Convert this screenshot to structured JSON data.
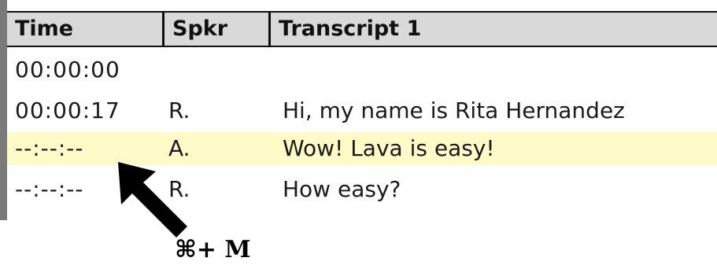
{
  "columns": {
    "time": "Time",
    "speaker": "Spkr",
    "transcript": "Transcript 1"
  },
  "rows": [
    {
      "time": "00:00:00",
      "speaker": "",
      "text": ""
    },
    {
      "time": "00:00:17",
      "speaker": "R.",
      "text": "Hi, my name is Rita Hernandez"
    },
    {
      "time": "--:--:--",
      "speaker": "A.",
      "text": "Wow!  Lava is easy!",
      "highlighted": true
    },
    {
      "time": "--:--:--",
      "speaker": "R.",
      "text": "How easy?"
    }
  ],
  "annotation": {
    "shortcut": "⌘+ M",
    "arrow_icon": "arrow-up-left-icon"
  },
  "colors": {
    "highlight_row": "#fffbc9",
    "header_bg": "#d9d9d9"
  }
}
